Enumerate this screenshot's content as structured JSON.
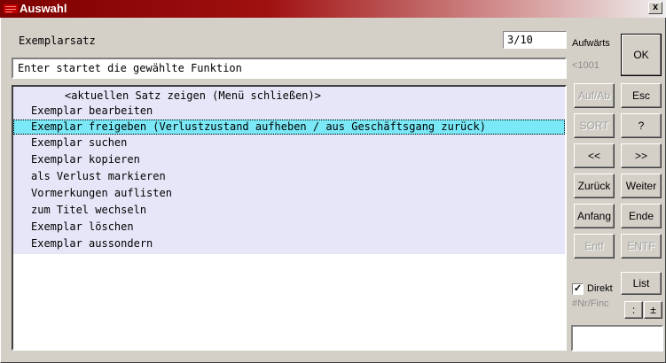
{
  "window": {
    "title": "Auswahl",
    "close_label": "x"
  },
  "header": {
    "set_label": "Exemplarsatz",
    "counter": "3/10",
    "status": "Enter startet die gewählte Funktion"
  },
  "list": {
    "items": [
      "<aktuellen Satz zeigen (Menü schließen)>",
      "Exemplar bearbeiten",
      "Exemplar freigeben (Verlustzustand aufheben / aus Geschäftsgang zurück)",
      "Exemplar suchen",
      "Exemplar kopieren",
      "als Verlust markieren",
      "Vormerkungen auflisten",
      "zum Titel wechseln",
      "Exemplar löschen",
      "Exemplar aussondern"
    ],
    "selected_index": 2
  },
  "side": {
    "direction_label": "Aufwärts",
    "range_label": "<1001",
    "ok": "OK",
    "esc": "Esc",
    "auf_ab": "Auf/Ab",
    "help": "?",
    "sort": "SORT",
    "prev": "<<",
    "next": ">>",
    "back": "Zurück",
    "forward": "Weiter",
    "start": "Anfang",
    "end": "Ende",
    "entf": "Entf",
    "entf_caps": "ENTF",
    "direct_label": "Direkt",
    "direct_checked": true,
    "list": "List",
    "nr_find": "#Nr/Finc",
    "colon": ":",
    "plusminus": "±",
    "bottom_value": ""
  },
  "colors": {
    "title_gradient_start": "#7e0000",
    "selection": "#7ae8f6",
    "list_bg": "#e6e6f8"
  }
}
